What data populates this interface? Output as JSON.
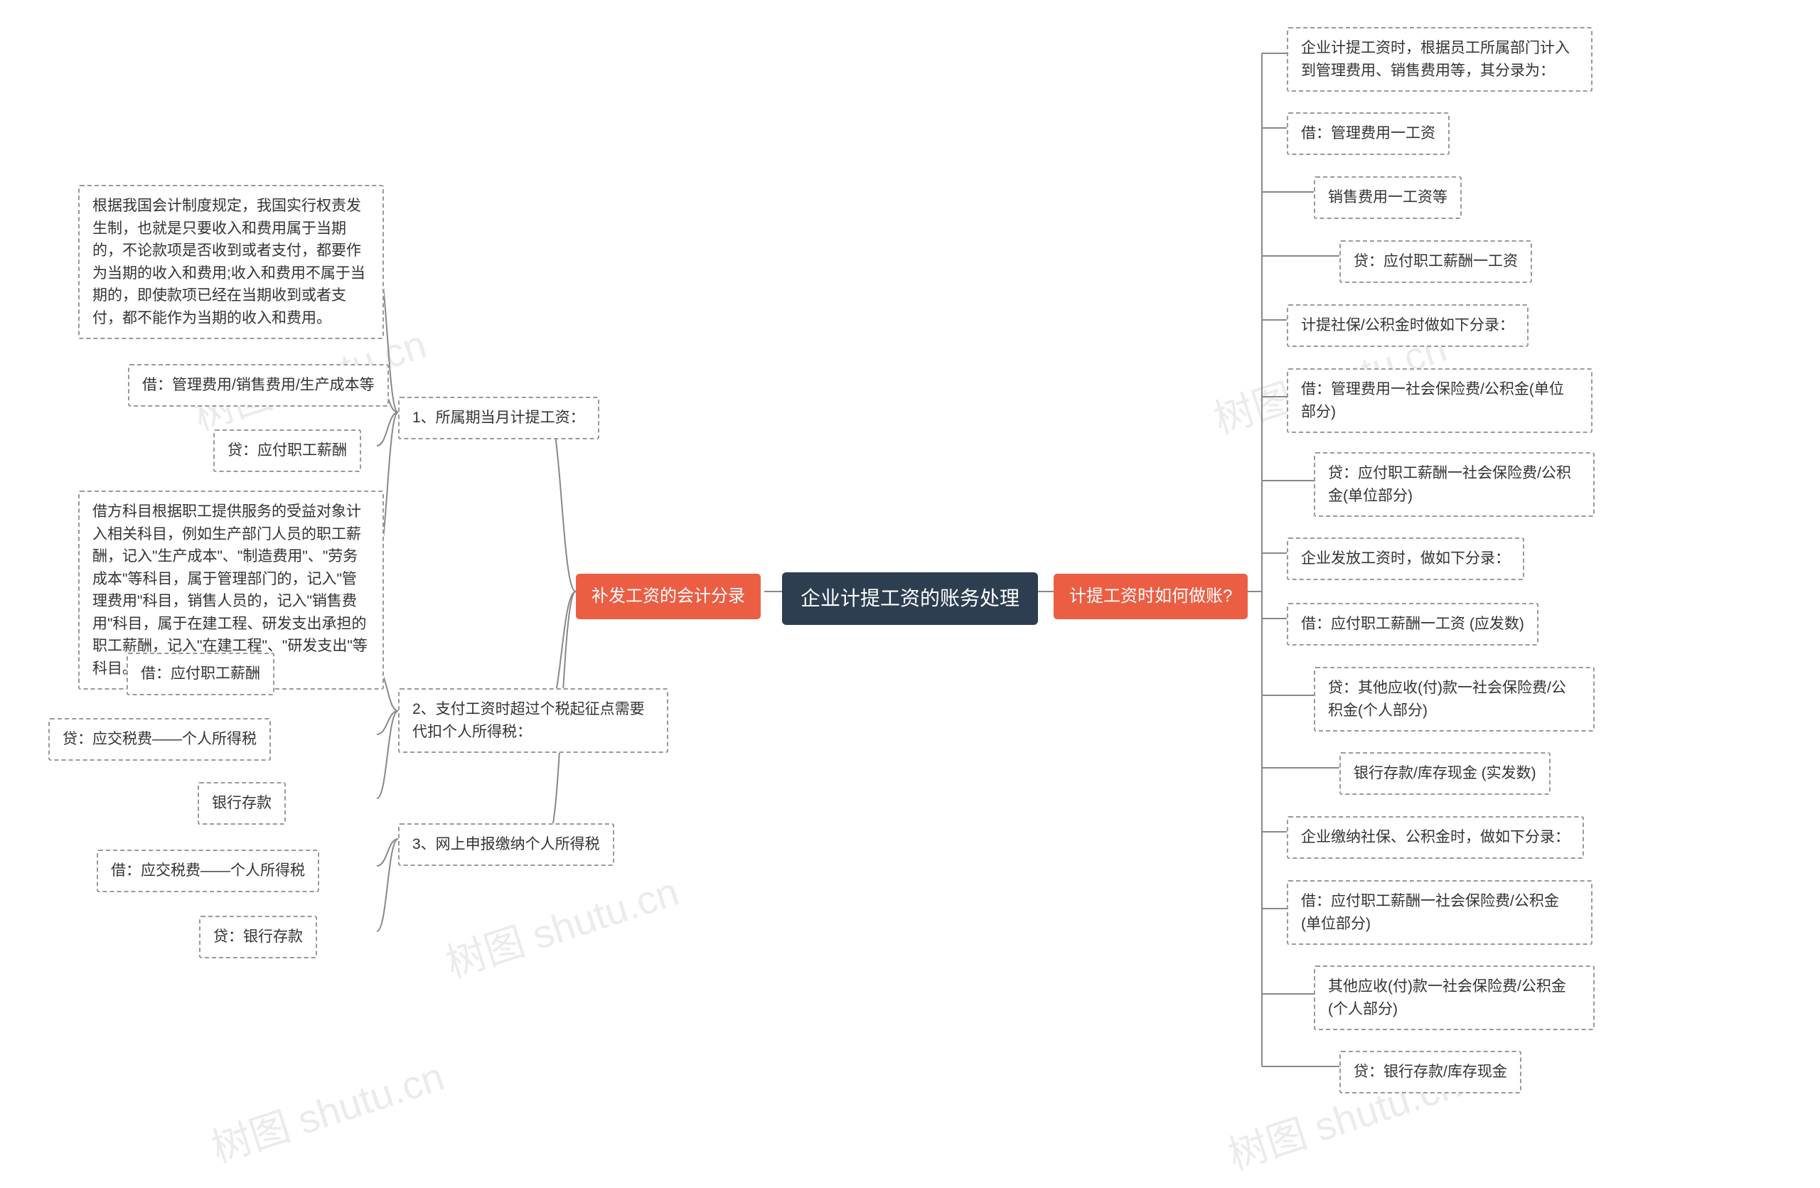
{
  "root": {
    "title": "企业计提工资的账务处理"
  },
  "left": {
    "label": "补发工资的会计分录",
    "sub": [
      {
        "label": "1、所属期当月计提工资：",
        "children": [
          "根据我国会计制度规定，我国实行权责发生制，也就是只要收入和费用属于当期的，不论款项是否收到或者支付，都要作为当期的收入和费用;收入和费用不属于当期的，即使款项已经在当期收到或者支付，都不能作为当期的收入和费用。",
          "借：管理费用/销售费用/生产成本等",
          "贷：应付职工薪酬",
          "借方科目根据职工提供服务的受益对象计入相关科目，例如生产部门人员的职工薪酬，记入\"生产成本\"、\"制造费用\"、\"劳务成本\"等科目，属于管理部门的，记入\"管理费用\"科目，销售人员的，记入\"销售费用\"科目，属于在建工程、研发支出承担的职工薪酬，记入\"在建工程\"、\"研发支出\"等科目。"
        ]
      },
      {
        "label": "2、支付工资时超过个税起征点需要代扣个人所得税：",
        "children": [
          "借：应付职工薪酬",
          "贷：应交税费——个人所得税",
          "银行存款"
        ]
      },
      {
        "label": "3、网上申报缴纳个人所得税",
        "children": [
          "借：应交税费——个人所得税",
          "贷：银行存款"
        ]
      }
    ]
  },
  "right": {
    "label": "计提工资时如何做账?",
    "children": [
      "企业计提工资时，根据员工所属部门计入到管理费用、销售费用等，其分录为：",
      "借：管理费用一工资",
      "销售费用一工资等",
      "贷：应付职工薪酬一工资",
      "计提社保/公积金时做如下分录：",
      "借：管理费用一社会保险费/公积金(单位部分)",
      "贷：应付职工薪酬一社会保险费/公积金(单位部分)",
      "企业发放工资时，做如下分录：",
      "借：应付职工薪酬一工资 (应发数)",
      "贷：其他应收(付)款一社会保险费/公积金(个人部分)",
      "银行存款/库存现金 (实发数)",
      "企业缴纳社保、公积金时，做如下分录：",
      "借：应付职工薪酬一社会保险费/公积金(单位部分)",
      "其他应收(付)款一社会保险费/公积金(个人部分)",
      "贷：银行存款/库存现金"
    ]
  },
  "watermark": "树图 shutu.cn"
}
